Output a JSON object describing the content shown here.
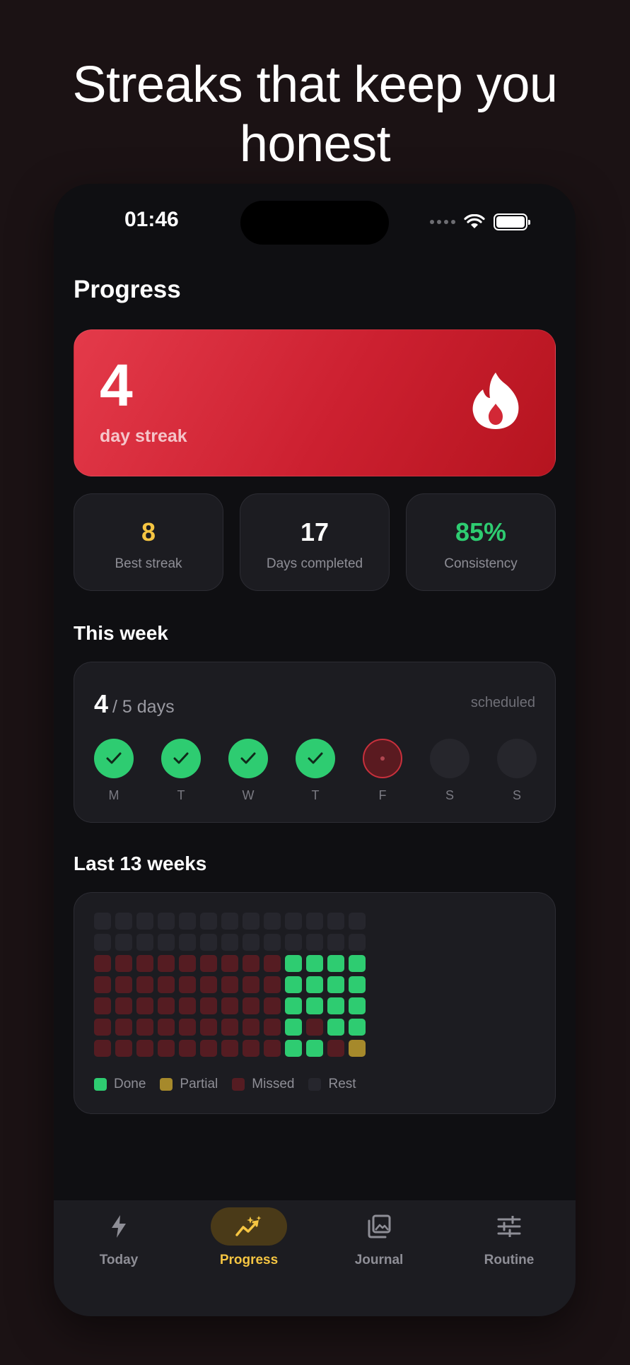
{
  "headline": "Streaks that keep you honest",
  "status_bar": {
    "time": "01:46"
  },
  "page": {
    "title": "Progress"
  },
  "streak": {
    "value": "4",
    "label": "day streak",
    "icon": "flame-icon"
  },
  "stats": [
    {
      "value": "8",
      "label": "Best streak",
      "color": "#f5c542"
    },
    {
      "value": "17",
      "label": "Days completed",
      "color": "#ffffff"
    },
    {
      "value": "85%",
      "label": "Consistency",
      "color": "#2ecc71"
    }
  ],
  "this_week": {
    "title": "This week",
    "count": "4",
    "total": "/ 5 days",
    "scheduled": "scheduled",
    "days": [
      {
        "letter": "M",
        "status": "done"
      },
      {
        "letter": "T",
        "status": "done"
      },
      {
        "letter": "W",
        "status": "done"
      },
      {
        "letter": "T",
        "status": "done"
      },
      {
        "letter": "F",
        "status": "missed"
      },
      {
        "letter": "S",
        "status": "rest"
      },
      {
        "letter": "S",
        "status": "rest"
      }
    ]
  },
  "history": {
    "title": "Last 13 weeks",
    "rows": [
      [
        "rest",
        "rest",
        "rest",
        "rest",
        "rest",
        "rest",
        "rest",
        "rest",
        "rest",
        "rest",
        "rest",
        "rest",
        "rest"
      ],
      [
        "rest",
        "rest",
        "rest",
        "rest",
        "rest",
        "rest",
        "rest",
        "rest",
        "rest",
        "rest",
        "rest",
        "rest",
        "rest"
      ],
      [
        "missed",
        "missed",
        "missed",
        "missed",
        "missed",
        "missed",
        "missed",
        "missed",
        "missed",
        "done",
        "done",
        "done",
        "done"
      ],
      [
        "missed",
        "missed",
        "missed",
        "missed",
        "missed",
        "missed",
        "missed",
        "missed",
        "missed",
        "done",
        "done",
        "done",
        "done"
      ],
      [
        "missed",
        "missed",
        "missed",
        "missed",
        "missed",
        "missed",
        "missed",
        "missed",
        "missed",
        "done",
        "done",
        "done",
        "done"
      ],
      [
        "missed",
        "missed",
        "missed",
        "missed",
        "missed",
        "missed",
        "missed",
        "missed",
        "missed",
        "done",
        "missed",
        "done",
        "done"
      ],
      [
        "missed",
        "missed",
        "missed",
        "missed",
        "missed",
        "missed",
        "missed",
        "missed",
        "missed",
        "done",
        "done",
        "missed",
        "partial"
      ]
    ],
    "legend": [
      {
        "key": "done",
        "label": "Done",
        "color": "#2ecc71"
      },
      {
        "key": "partial",
        "label": "Partial",
        "color": "#a6892b"
      },
      {
        "key": "missed",
        "label": "Missed",
        "color": "#551c22"
      },
      {
        "key": "rest",
        "label": "Rest",
        "color": "#26262d"
      }
    ]
  },
  "tabs": [
    {
      "label": "Today",
      "icon": "bolt-icon",
      "active": false
    },
    {
      "label": "Progress",
      "icon": "chart-sparkle-icon",
      "active": true
    },
    {
      "label": "Journal",
      "icon": "photo-stack-icon",
      "active": false
    },
    {
      "label": "Routine",
      "icon": "sliders-icon",
      "active": false
    }
  ],
  "colors": {
    "accent": "#f5c542",
    "streak_red": "#d62a3a",
    "done_green": "#2ecc71"
  }
}
